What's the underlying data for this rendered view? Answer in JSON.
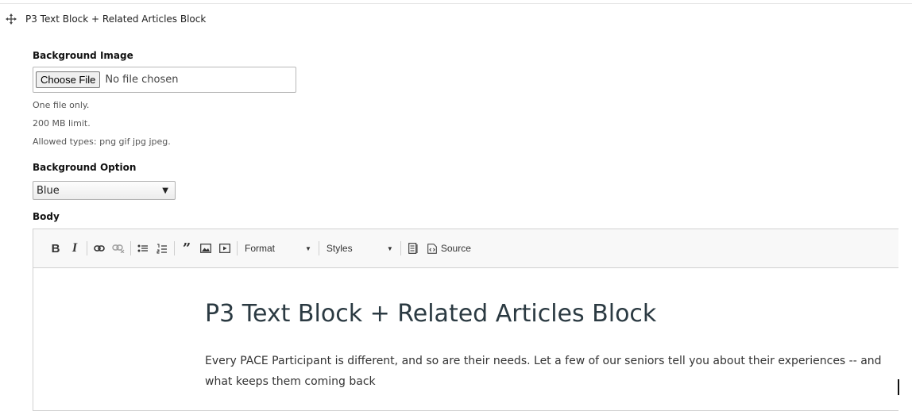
{
  "block": {
    "title": "P3 Text Block + Related Articles Block"
  },
  "background_image": {
    "label": "Background Image",
    "choose_button": "Choose File",
    "no_file": "No file chosen",
    "desc_one_file": "One file only.",
    "desc_limit": "200 MB limit.",
    "desc_types": "Allowed types: png gif jpg jpeg."
  },
  "background_option": {
    "label": "Background Option",
    "selected": "Blue"
  },
  "body": {
    "label": "Body",
    "toolbar": {
      "bold": "B",
      "italic": "I",
      "format": "Format",
      "styles": "Styles",
      "source": "Source"
    },
    "content": {
      "heading": "P3 Text Block + Related Articles Block",
      "paragraph": "Every PACE Participant is different, and so are their needs.  Let a few of our seniors tell you about their experiences -- and what keeps them coming back"
    }
  },
  "colors": {
    "heading": "#2b3a42",
    "toolbar_bg": "#f8f8f8",
    "border": "#d1d1d1"
  }
}
